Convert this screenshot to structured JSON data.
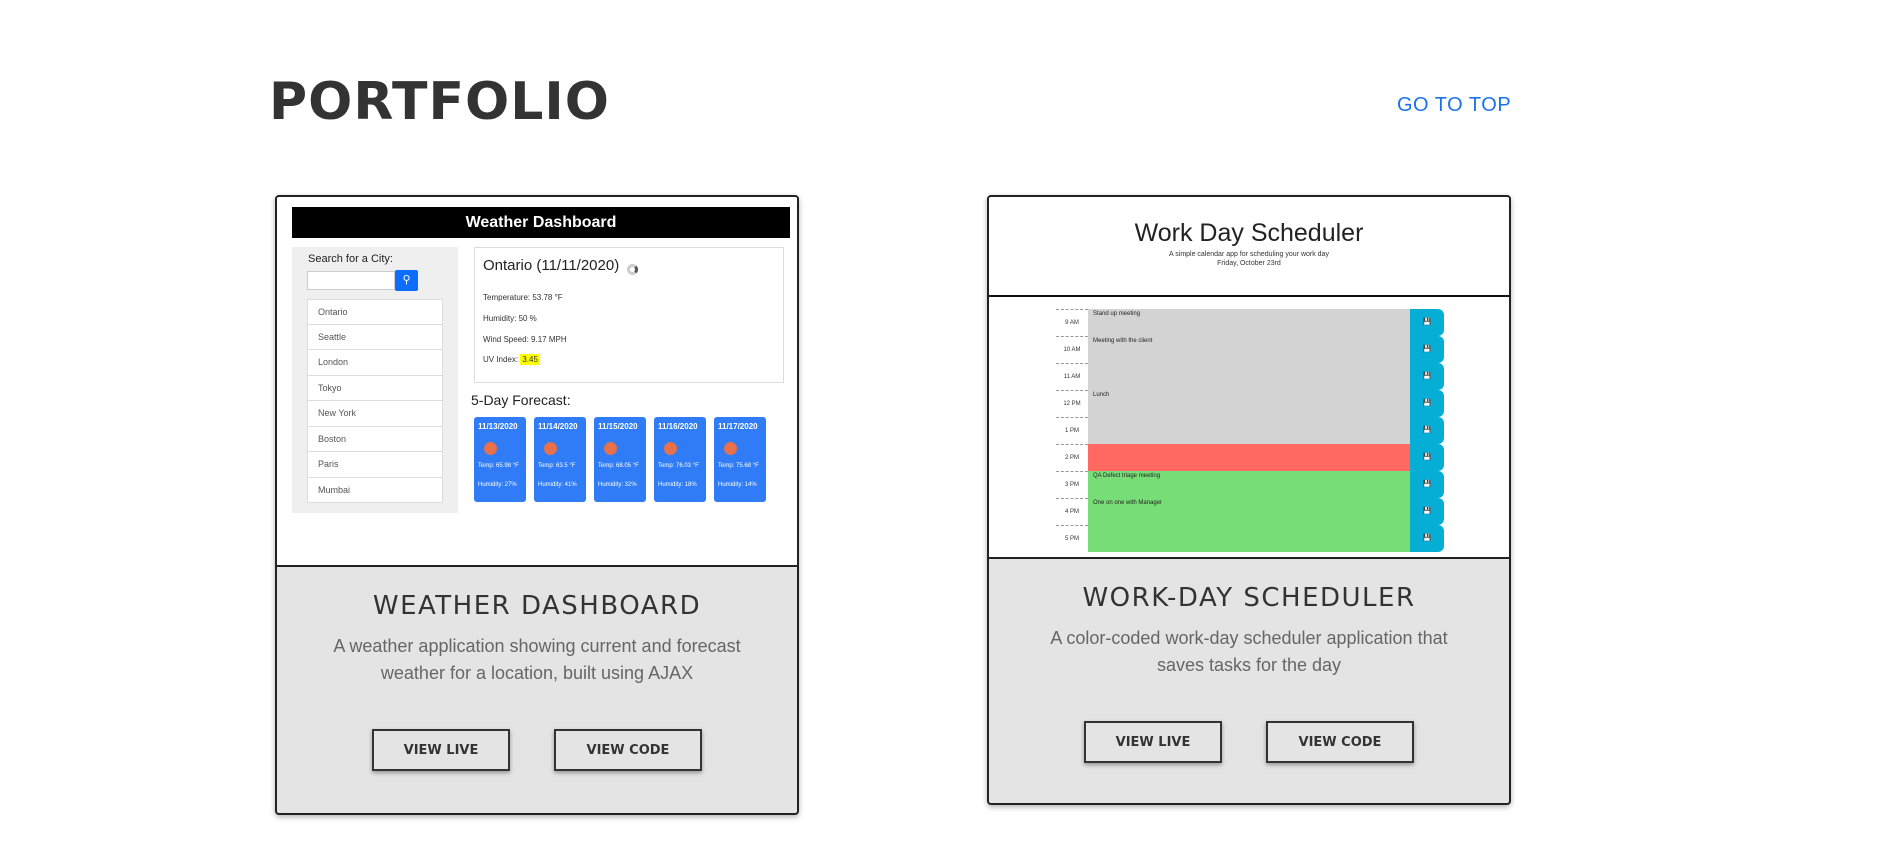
{
  "header": {
    "title": "PORTFOLIO",
    "top_link": "GO TO TOP"
  },
  "projects": [
    {
      "title": "WEATHER DASHBOARD",
      "description": "A weather application showing current and forecast weather for a location, built using AJAX",
      "view_live": "VIEW LIVE",
      "view_code": "VIEW CODE",
      "preview": {
        "header": "Weather Dashboard",
        "search_label": "Search for a City:",
        "search_icon": "search-icon",
        "cities": [
          "Ontario",
          "Seattle",
          "London",
          "Tokyo",
          "New York",
          "Boston",
          "Paris",
          "Mumbai"
        ],
        "current_city": "Ontario (11/11/2020)",
        "temperature": "Temperature: 53.78 °F",
        "humidity": "Humidity: 50 %",
        "wind": "Wind Speed: 9.17 MPH",
        "uv_label": "UV Index:",
        "uv_value": "3.45",
        "forecast_title": "5-Day Forecast:",
        "forecast": [
          {
            "date": "11/13/2020",
            "temp": "Temp: 65.98 °F",
            "humidity": "Humidity: 27%"
          },
          {
            "date": "11/14/2020",
            "temp": "Temp: 63.5 °F",
            "humidity": "Humidity: 41%"
          },
          {
            "date": "11/15/2020",
            "temp": "Temp: 68.05 °F",
            "humidity": "Humidity: 32%"
          },
          {
            "date": "11/16/2020",
            "temp": "Temp: 76.03 °F",
            "humidity": "Humidity: 18%"
          },
          {
            "date": "11/17/2020",
            "temp": "Temp: 75.68 °F",
            "humidity": "Humidity: 14%"
          }
        ]
      }
    },
    {
      "title": "WORK-DAY SCHEDULER",
      "description": "A color-coded work-day scheduler application that saves tasks for the day",
      "view_live": "VIEW LIVE",
      "view_code": "VIEW CODE",
      "preview": {
        "title": "Work Day Scheduler",
        "subtitle": "A simple calendar app for scheduling your work day",
        "date": "Friday, October 23rd",
        "save_icon": "save-icon",
        "rows": [
          {
            "hour": "9 AM",
            "task": "Stand up meeting",
            "state": "past"
          },
          {
            "hour": "10 AM",
            "task": "Meeting with the client",
            "state": "past"
          },
          {
            "hour": "11 AM",
            "task": "",
            "state": "past"
          },
          {
            "hour": "12 PM",
            "task": "Lunch",
            "state": "past"
          },
          {
            "hour": "1 PM",
            "task": "",
            "state": "past"
          },
          {
            "hour": "2 PM",
            "task": "",
            "state": "present"
          },
          {
            "hour": "3 PM",
            "task": "QA Defect triage meeting",
            "state": "future"
          },
          {
            "hour": "4 PM",
            "task": "One on one with Manager",
            "state": "future"
          },
          {
            "hour": "5 PM",
            "task": "",
            "state": "future"
          }
        ]
      }
    }
  ],
  "colors": {
    "link": "#1a73e8",
    "card_bg": "#e4e4e4",
    "past": "#d3d3d3",
    "present": "#ff6961",
    "future": "#77dd77",
    "save": "#06aed5",
    "forecast": "#2f7cf6"
  }
}
